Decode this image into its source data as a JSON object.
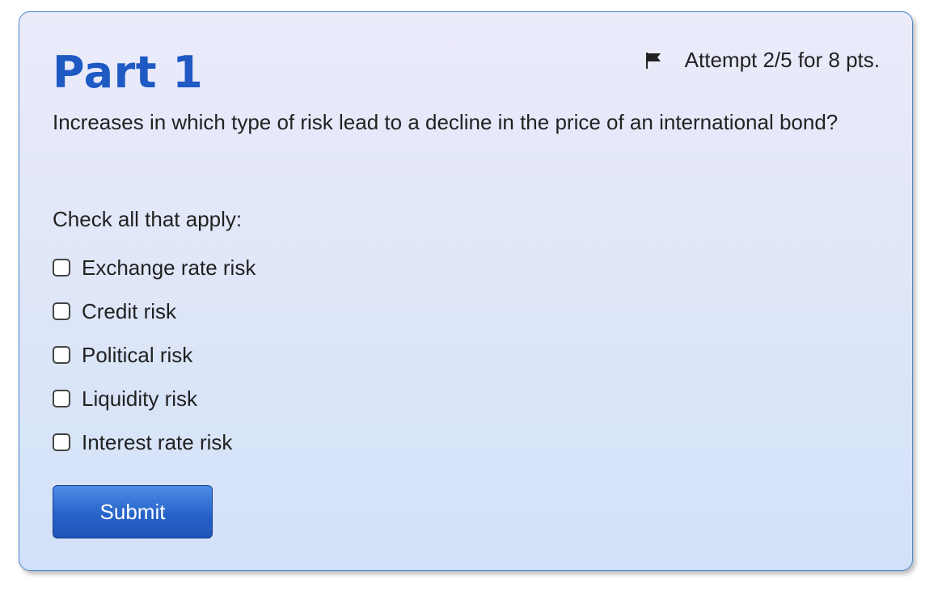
{
  "part": {
    "title": "Part 1",
    "attempt_text": "Attempt 2/5 for 8 pts.",
    "flag_icon": "flag-icon"
  },
  "question": {
    "text": "Increases in which type of risk lead to a decline in the price of an international bond?",
    "instruction": "Check all that apply:"
  },
  "options": [
    {
      "label": "Exchange rate risk",
      "checked": false
    },
    {
      "label": "Credit risk",
      "checked": false
    },
    {
      "label": "Political risk",
      "checked": false
    },
    {
      "label": "Liquidity risk",
      "checked": false
    },
    {
      "label": "Interest rate risk",
      "checked": false
    }
  ],
  "actions": {
    "submit_label": "Submit"
  },
  "colors": {
    "title": "#1f59c4",
    "card_border": "#4a86c8",
    "button": "#2763c9"
  }
}
